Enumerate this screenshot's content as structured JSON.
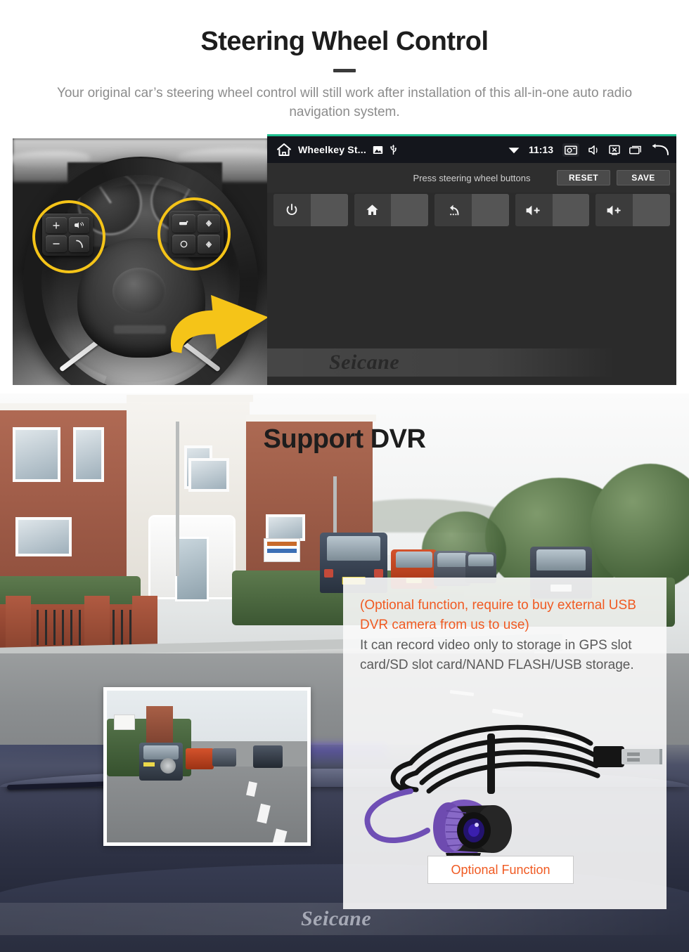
{
  "steering_section": {
    "title": "Steering Wheel Control",
    "subtitle": "Your original car’s steering wheel control will still work after installation of this all-in-one auto radio navigation system.",
    "wheel_photo": {
      "name": "steering-wheel-photo",
      "highlight_color": "#f5c418",
      "left_pad_keys": [
        "volume-up",
        "voice-assistant",
        "volume-down",
        "phone-call"
      ],
      "right_pad_keys": [
        "media-source",
        "arrow-up",
        "mode-circle",
        "arrow-down"
      ],
      "arrow_color": "#f5c418"
    },
    "head_unit": {
      "accent_color": "#1fbf8f",
      "status_bar": {
        "home_icon": "home-outline-icon",
        "app_title": "Wheelkey St...",
        "image_icon": "image-icon",
        "usb_icon": "usb-icon",
        "wifi_icon": "wifi-icon",
        "clock": "11:13",
        "screenshot_icon": "screenshot-camera-icon",
        "mute_icon": "speaker-mute-icon",
        "screen_off_icon": "screen-off-icon",
        "recents_icon": "recent-apps-icon",
        "back_icon": "back-arrow-icon"
      },
      "action_bar": {
        "hint": "Press steering wheel buttons",
        "reset_label": "RESET",
        "save_label": "SAVE"
      },
      "keys": [
        {
          "icon": "power-icon",
          "value": ""
        },
        {
          "icon": "home-icon",
          "value": ""
        },
        {
          "icon": "back-icon",
          "value": ""
        },
        {
          "icon": "volume-up-icon",
          "value": ""
        },
        {
          "icon": "volume-up-icon",
          "value": ""
        }
      ],
      "watermark": "Seicane"
    }
  },
  "dvr_section": {
    "title": "Support DVR",
    "note": "(Optional function, require to buy external USB DVR camera from us to use)",
    "description": "It can record video only to storage in GPS slot card/SD slot card/NAND FLASH/USB storage.",
    "optional_button_label": "Optional Function",
    "note_color": "#f05a22",
    "watermark": "Seicane",
    "dashcam_preview_name": "dashcam-video-preview",
    "camera_photo_name": "usb-dvr-camera-photo"
  }
}
